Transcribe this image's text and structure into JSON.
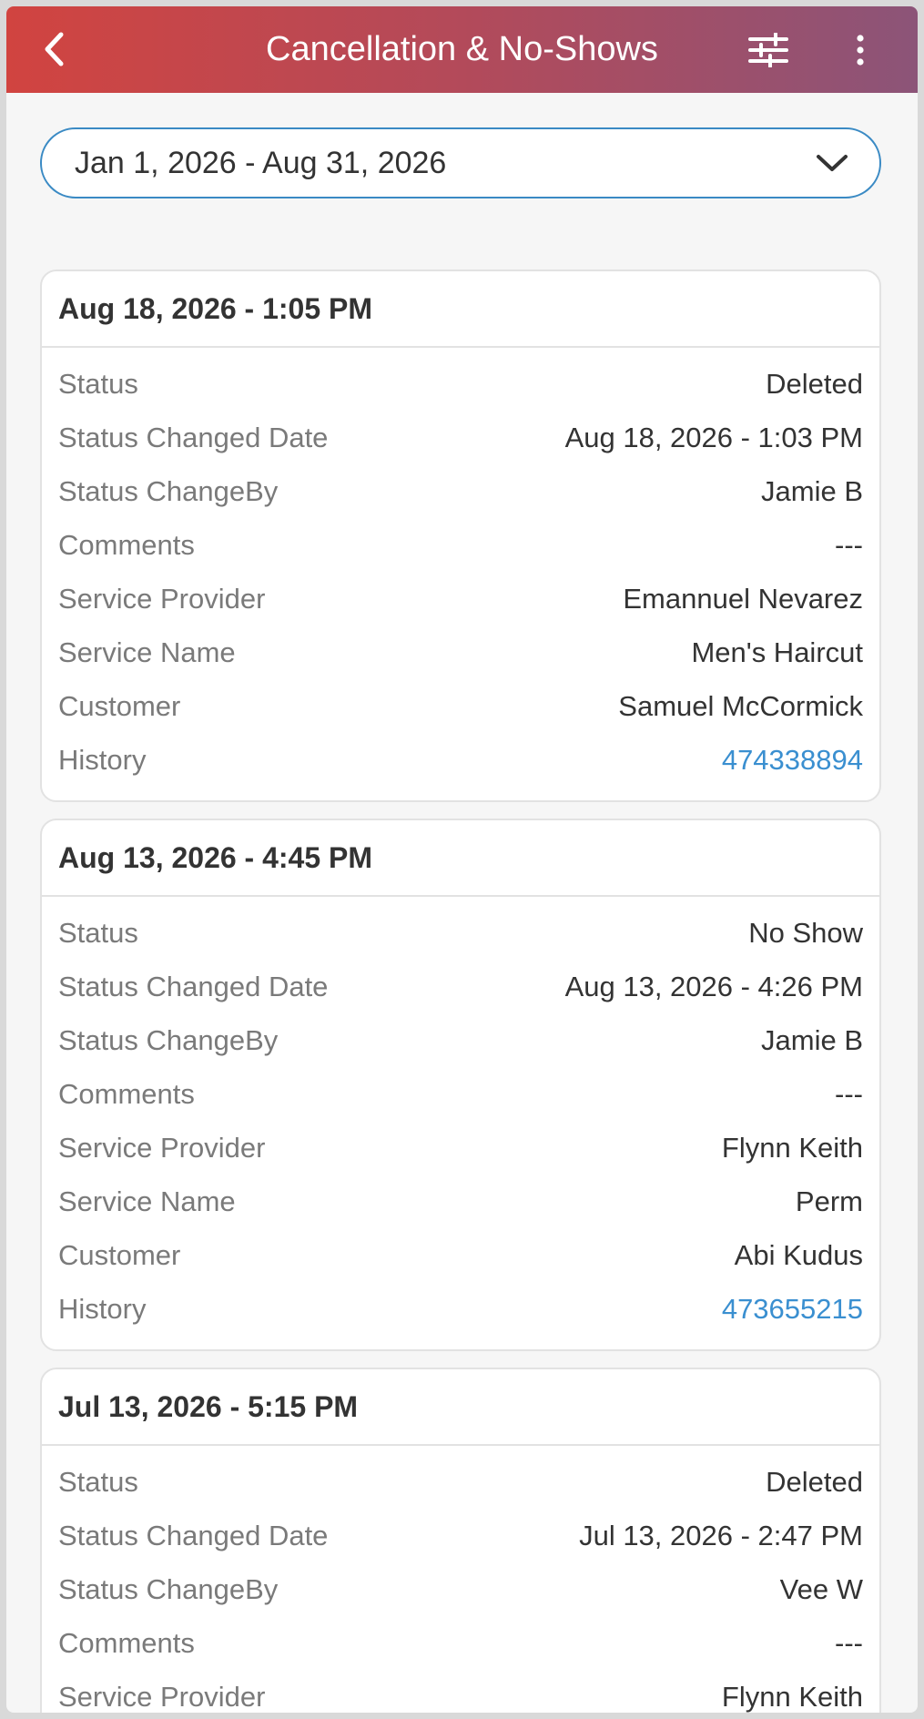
{
  "header": {
    "title": "Cancellation & No-Shows"
  },
  "filter": {
    "date_range": "Jan 1, 2026 - Aug 31, 2026"
  },
  "records": [
    {
      "title": "Aug 18, 2026 - 1:05 PM",
      "fields": [
        {
          "label": "Status",
          "value": "Deleted"
        },
        {
          "label": "Status Changed Date",
          "value": "Aug 18, 2026 - 1:03 PM"
        },
        {
          "label": "Status ChangeBy",
          "value": "Jamie B"
        },
        {
          "label": "Comments",
          "value": "---"
        },
        {
          "label": "Service Provider",
          "value": "Emannuel Nevarez"
        },
        {
          "label": "Service Name",
          "value": "Men's Haircut"
        },
        {
          "label": "Customer",
          "value": "Samuel McCormick"
        },
        {
          "label": "History",
          "value": "474338894"
        }
      ]
    },
    {
      "title": "Aug 13, 2026 - 4:45 PM",
      "fields": [
        {
          "label": "Status",
          "value": "No Show"
        },
        {
          "label": "Status Changed Date",
          "value": "Aug 13, 2026 - 4:26 PM"
        },
        {
          "label": "Status ChangeBy",
          "value": "Jamie B"
        },
        {
          "label": "Comments",
          "value": "---"
        },
        {
          "label": "Service Provider",
          "value": "Flynn Keith"
        },
        {
          "label": "Service Name",
          "value": "Perm"
        },
        {
          "label": "Customer",
          "value": "Abi Kudus"
        },
        {
          "label": "History",
          "value": "473655215"
        }
      ]
    },
    {
      "title": "Jul 13, 2026 - 5:15 PM",
      "fields": [
        {
          "label": "Status",
          "value": "Deleted"
        },
        {
          "label": "Status Changed Date",
          "value": "Jul 13, 2026 - 2:47 PM"
        },
        {
          "label": "Status ChangeBy",
          "value": "Vee W"
        },
        {
          "label": "Comments",
          "value": "---"
        },
        {
          "label": "Service Provider",
          "value": "Flynn Keith"
        }
      ]
    }
  ],
  "colors": {
    "header_start": "#d14440",
    "header_end": "#8c5478",
    "accent": "#3a8ac4",
    "link": "#3a8fd0"
  },
  "icons": {
    "back": "chevron-left-icon",
    "filter": "sliders-icon",
    "more": "more-vertical-icon",
    "dropdown": "chevron-down-icon"
  }
}
